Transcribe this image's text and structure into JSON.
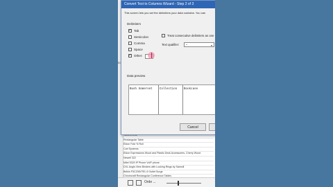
{
  "dialog": {
    "title": "Convert Text to Columns Wizard - Step 2 of 3",
    "description": "This screen lets you set the delimiters your data contains. You can",
    "delimiters_label": "Delimiters",
    "delimiters": [
      {
        "label": "Tab",
        "checked": true
      },
      {
        "label": "Semicolon",
        "checked": false
      },
      {
        "label": "Comma",
        "checked": false
      },
      {
        "label": "Space",
        "checked": false
      },
      {
        "label": "Other:",
        "checked": true
      }
    ],
    "consecutive_label": "Treat consecutive delimiters as one",
    "text_qualifier_label": "Text qualifier:",
    "text_qualifier_value": "\"",
    "data_preview_label": "Data preview",
    "preview_columns": [
      "Bush Somerset",
      "Collection",
      "Bookcase"
    ],
    "cancel_label": "Cancel"
  },
  "sheet": {
    "row_label": "B3",
    "rows": [
      "Tables Desk",
      "Rectangular Table",
      "Eldon Fold 'N Roll",
      "Cart Systems",
      "Eldon Expressions Wood and Plastic Desk Accessories, Cherry Wood",
      "Newell 322",
      "Mitel 5320 IP Phone VoIP phone",
      "DXL Angle-View Binders with Locking Rings by Samsill",
      "Belkin F5C206VTEL 6 Outlet Surge",
      "Chromcraft Rectangular Conference Tables",
      "Konftel 250 Conference phone - Charcoal black"
    ],
    "tab_label": "Orde ..."
  }
}
